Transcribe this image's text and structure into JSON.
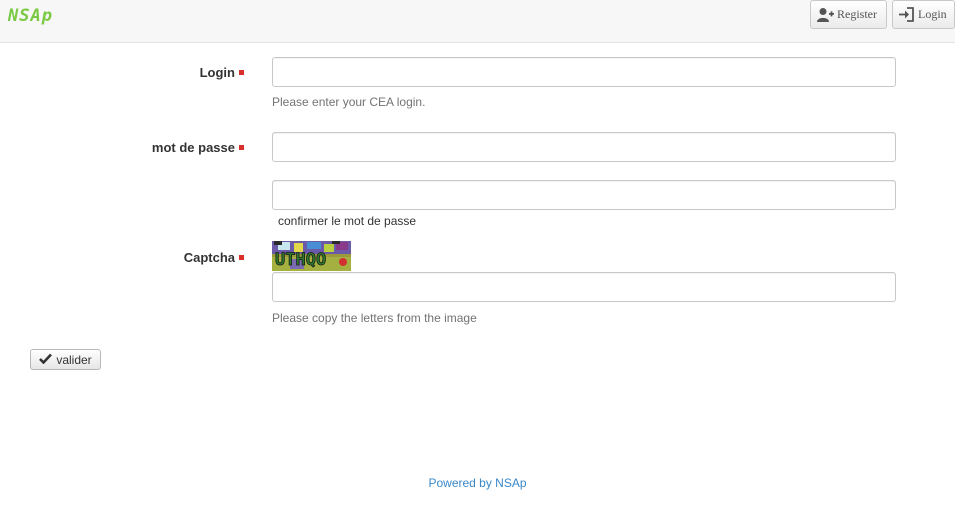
{
  "navbar": {
    "brand": "NSAp",
    "register_label": "Register",
    "login_label": "Login"
  },
  "form": {
    "login": {
      "label": "Login",
      "value": "",
      "help": "Please enter your CEA login."
    },
    "password": {
      "label": "mot de passe",
      "value": "",
      "confirm_value": "",
      "confirm_help": "confirmer le mot de passe"
    },
    "captcha": {
      "label": "Captcha",
      "image_text": "UTHQO",
      "value": "",
      "help": "Please copy the letters from the image"
    },
    "submit_label": "valider"
  },
  "footer": {
    "text": "Powered by NSAp"
  },
  "colors": {
    "brand": "#7ac943",
    "required_marker": "#d9302c",
    "link": "#3a87c8",
    "help_text": "#737373"
  }
}
